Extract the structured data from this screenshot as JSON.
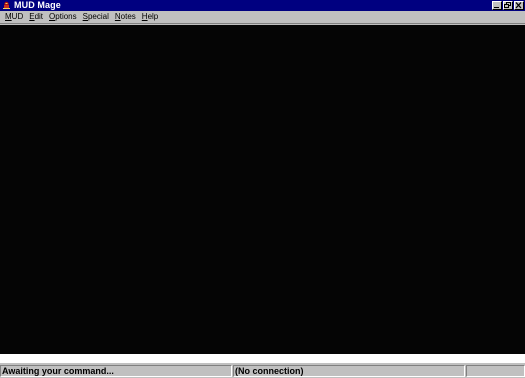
{
  "window": {
    "title": "MUD Mage",
    "icon": "mud-mage-app-icon",
    "title_buttons": [
      "minimize-icon",
      "restore-icon",
      "close-icon"
    ],
    "title_bar_color": "#000080"
  },
  "menu": {
    "items": [
      {
        "label": "MUD",
        "accel": "M"
      },
      {
        "label": "Edit",
        "accel": "E"
      },
      {
        "label": "Options",
        "accel": "O"
      },
      {
        "label": "Special",
        "accel": "S"
      },
      {
        "label": "Notes",
        "accel": "N"
      },
      {
        "label": "Help",
        "accel": "H"
      }
    ]
  },
  "terminal": {
    "background": "#050505",
    "output": ""
  },
  "input": {
    "value": ""
  },
  "status": {
    "message": "Awaiting your command...",
    "connection": "(No connection)",
    "extra": ""
  }
}
